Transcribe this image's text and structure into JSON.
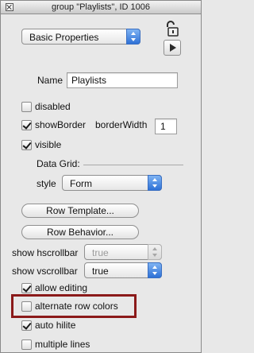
{
  "window": {
    "title": "group \"Playlists\", ID 1006"
  },
  "pane_selector": {
    "value": "Basic Properties"
  },
  "name_field": {
    "label": "Name",
    "value": "Playlists"
  },
  "checkboxes": {
    "disabled": {
      "label": "disabled",
      "checked": false
    },
    "show_border": {
      "label": "showBorder",
      "checked": true
    },
    "visible": {
      "label": "visible",
      "checked": true
    },
    "allow_editing": {
      "label": "allow editing",
      "checked": true
    },
    "alternate_row_colors": {
      "label": "alternate row colors",
      "checked": false
    },
    "auto_hilite": {
      "label": "auto hilite",
      "checked": true
    },
    "multiple_lines": {
      "label": "multiple lines",
      "checked": false
    }
  },
  "border_width": {
    "label": "borderWidth",
    "value": "1"
  },
  "data_grid": {
    "section_label": "Data Grid:",
    "style_label": "style",
    "style_value": "Form",
    "row_template_button": "Row Template...",
    "row_behavior_button": "Row Behavior..."
  },
  "scrollbars": {
    "h_label": "show hscrollbar",
    "h_value": "true",
    "v_label": "show vscrollbar",
    "v_value": "true"
  },
  "icons": [
    "close-icon",
    "lock-icon",
    "play-icon",
    "checkmark-icon",
    "stepper-arrows-icon"
  ],
  "colors": {
    "highlight_border": "#8b1a1a",
    "popup_accent": "#2e71d6"
  }
}
